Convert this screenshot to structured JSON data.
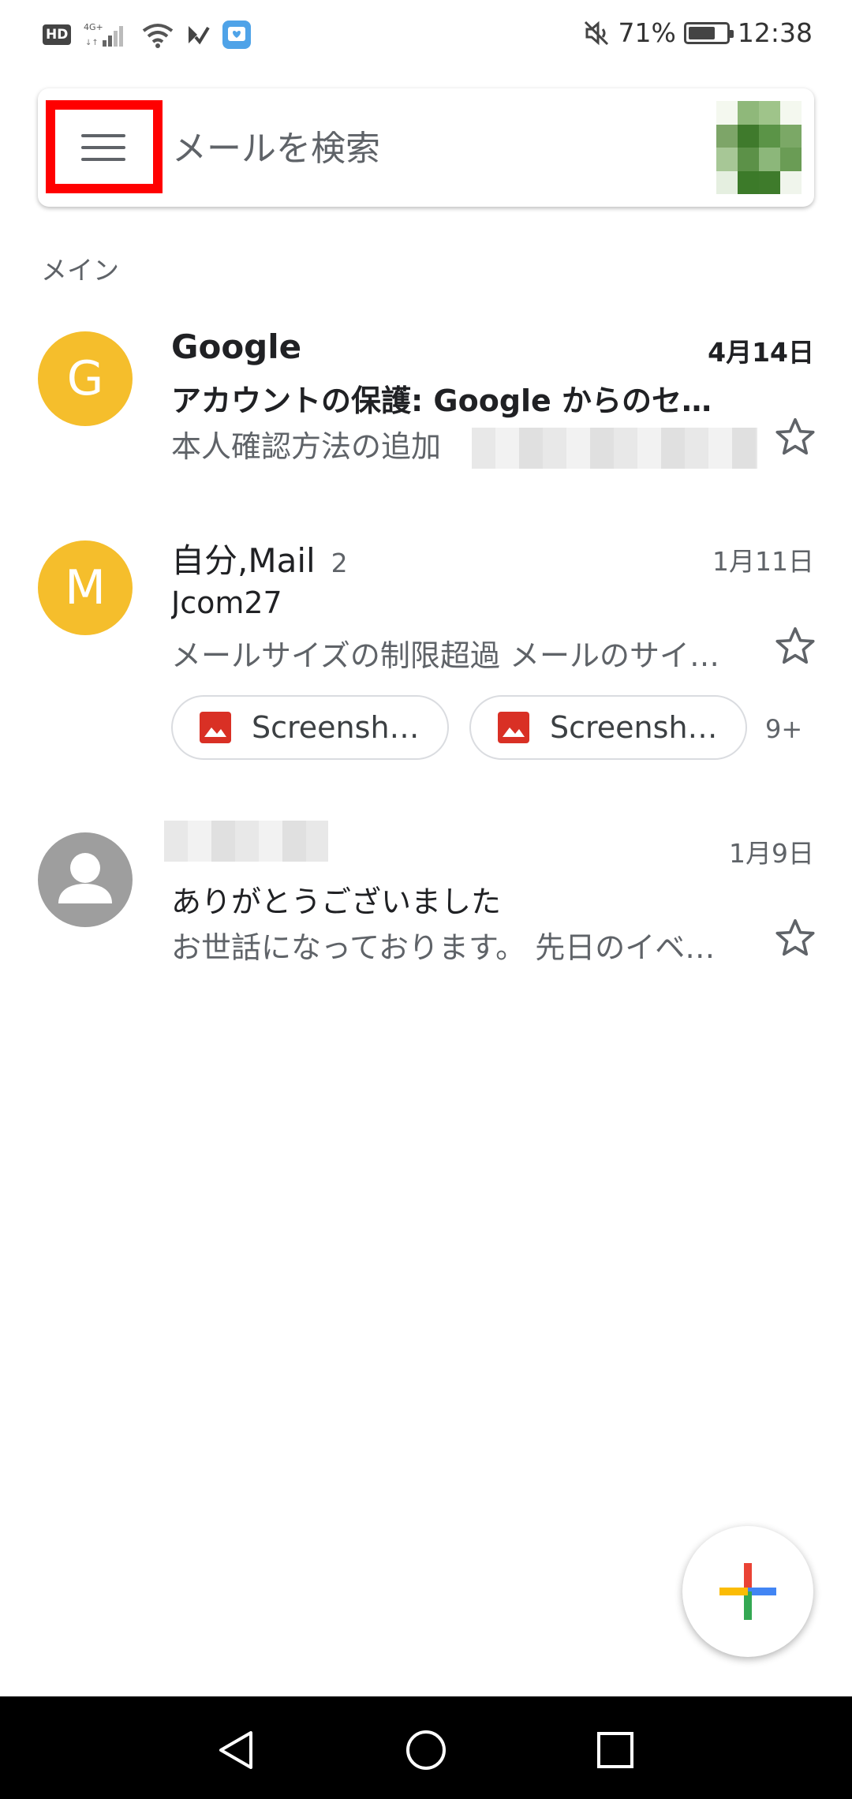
{
  "status_bar": {
    "hd": "HD",
    "network": "4G+",
    "battery_percent": "71%",
    "battery_level": 0.71,
    "time": "12:38"
  },
  "search": {
    "placeholder": "メールを検索"
  },
  "section_label": "メイン",
  "mails": [
    {
      "avatar_letter": "G",
      "avatar_color": "#F5BE2C",
      "sender": "Google",
      "date": "4月14日",
      "subject": "アカウントの保護: Google からのセ…",
      "snippet": "本人確認方法の追加",
      "unread": true
    },
    {
      "avatar_letter": "M",
      "avatar_color": "#F5BE2C",
      "sender": "自分,Mail",
      "count": "2",
      "date": "1月11日",
      "subject": "Jcom27",
      "snippet": "メールサイズの制限超過 メールのサイ…",
      "attachments": [
        "Screensh…",
        "Screensh…"
      ],
      "more_attachments": "9+",
      "unread": false
    },
    {
      "avatar_color": "#9E9E9E",
      "date": "1月9日",
      "subject": "ありがとうございました",
      "snippet": "お世話になっております。 先日のイベ…",
      "unread": false
    }
  ],
  "colors": {
    "highlight": "#FF0000",
    "fab_red": "#EA4335",
    "fab_blue": "#4285F4",
    "fab_green": "#34A853",
    "fab_yellow": "#FBBC05"
  }
}
